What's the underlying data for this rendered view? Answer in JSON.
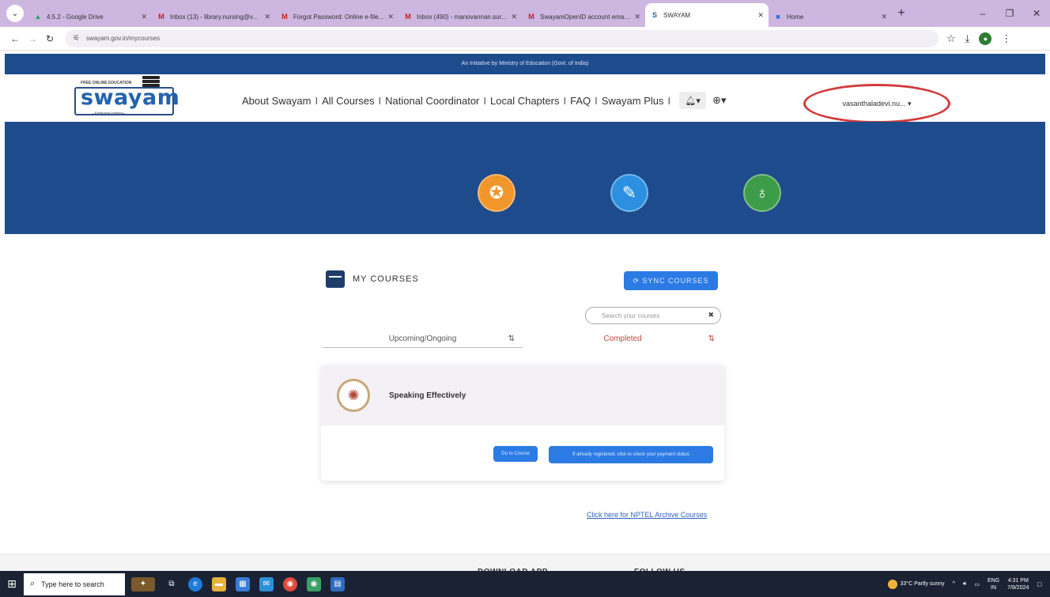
{
  "browser": {
    "tabs": [
      {
        "title": "4.5.2 - Google Drive",
        "icon": "google-drive-icon",
        "fav": "▲",
        "color": "#1fa463",
        "active": false
      },
      {
        "title": "Inbox (13) - library.nursing@v...",
        "icon": "gmail-icon",
        "fav": "M",
        "color": "#c5221f",
        "active": false
      },
      {
        "title": "Forgot Password: Online e-file...",
        "icon": "gmail-icon",
        "fav": "M",
        "color": "#c5221f",
        "active": false
      },
      {
        "title": "Inbox (490) - manovannan.sur...",
        "icon": "gmail-icon",
        "fav": "M",
        "color": "#c5221f",
        "active": false
      },
      {
        "title": "SwayamOpenID account email...",
        "icon": "gmail-icon",
        "fav": "M",
        "color": "#c5221f",
        "active": false
      },
      {
        "title": "SWAYAM",
        "icon": "swayam-icon",
        "fav": "S",
        "color": "#2363ad",
        "active": true
      },
      {
        "title": "Home",
        "icon": "home-icon",
        "fav": "■",
        "color": "#2f6fd6",
        "active": false
      }
    ],
    "new_tab": "+",
    "url": "swayam.gov.in/mycourses"
  },
  "initiative_text": "An Initiative by Ministry of Education (Govt. of India)",
  "logo": {
    "tagline": "FREE ONLINE EDUCATION",
    "word": "swayam",
    "sub": "—Enhancing Learning—"
  },
  "nav": {
    "items": [
      "About Swayam",
      "All Courses",
      "National Coordinator",
      "Local Chapters",
      "FAQ",
      "Swayam Plus"
    ],
    "separator": "I",
    "user": "vasanthaladevi.nu... ▾"
  },
  "my_courses": {
    "title": "MY COURSES",
    "sync_label": "⟳ SYNC COURSES",
    "search_placeholder": "Search your courses",
    "tabs": {
      "upcoming": "Upcoming/Ongoing",
      "completed": "Completed"
    },
    "course": {
      "name": "Speaking Effectively",
      "go_label": "Go to Course",
      "payment_label": "If already registered, click to check your payment status"
    },
    "archive_link": "Click here for NPTEL Archive Courses"
  },
  "footer": {
    "download": "DOWNLOAD APP",
    "follow": "FOLLOW US"
  },
  "taskbar": {
    "search_placeholder": "Type here to search",
    "weather": "33°C  Partly sunny",
    "lang": "ENG",
    "lang2": "IN",
    "time": "4:31 PM",
    "date": "7/8/2024"
  }
}
